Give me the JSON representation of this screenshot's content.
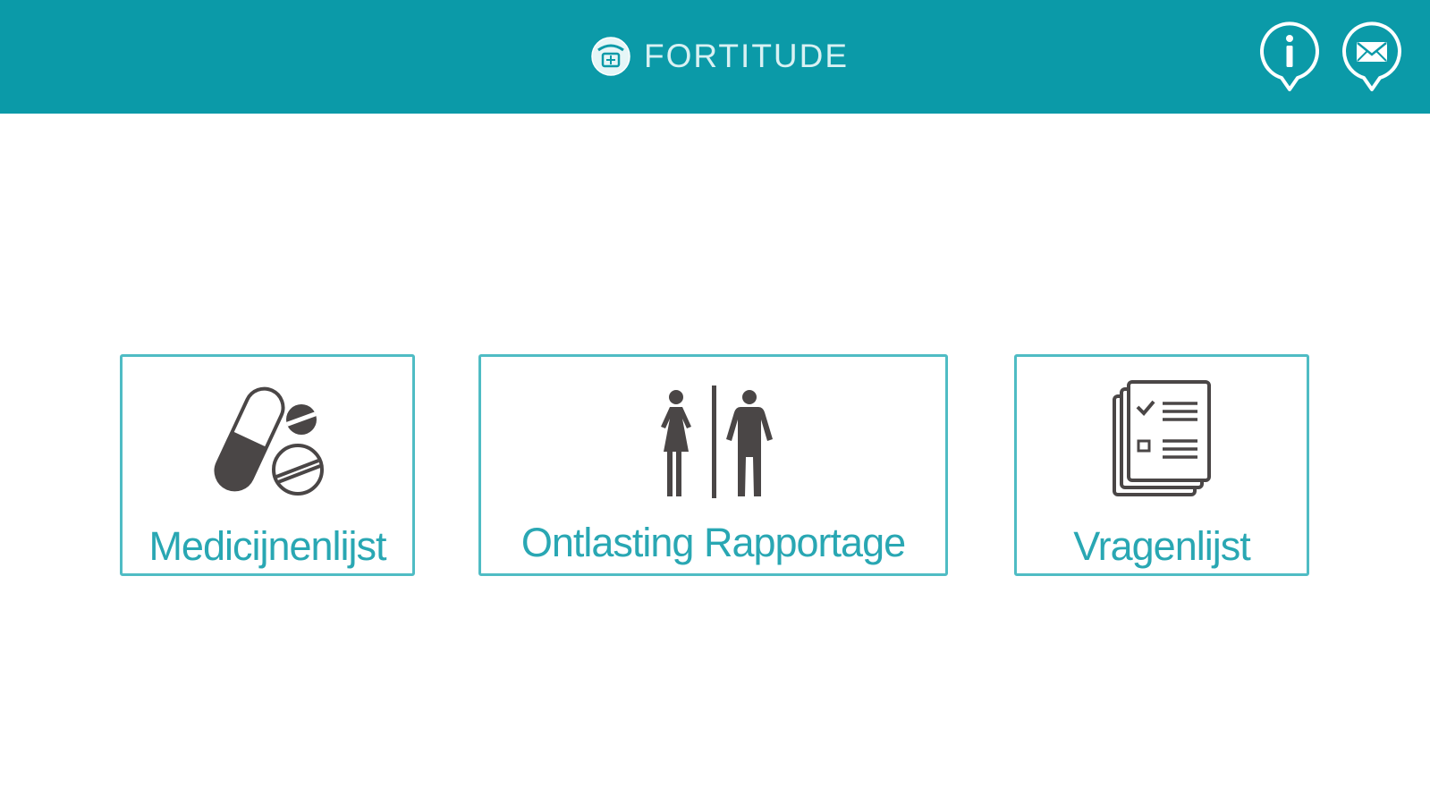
{
  "header": {
    "app_name": "FORTITUDE",
    "logo_icon": "fortitude-logo-icon",
    "info_icon": "info-pin-icon",
    "mail_icon": "mail-pin-icon",
    "background_color": "#0b9aa8"
  },
  "tiles": [
    {
      "label": "Medicijnenlijst",
      "icon": "pills-icon"
    },
    {
      "label": "Ontlasting Rapportage",
      "icon": "restroom-icon"
    },
    {
      "label": "Vragenlijst",
      "icon": "checklist-icon"
    }
  ],
  "colors": {
    "accent": "#29a7b3",
    "tile_border": "#4fbcc4",
    "icon": "#4a4646"
  }
}
